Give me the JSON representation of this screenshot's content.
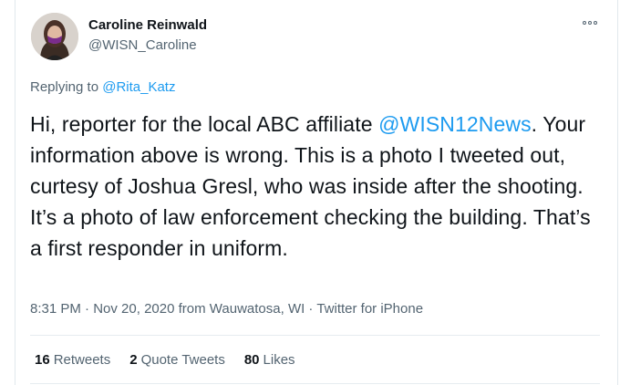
{
  "author": {
    "name": "Caroline Reinwald",
    "handle": "@WISN_Caroline"
  },
  "reply": {
    "prefix": "Replying to ",
    "to": "@Rita_Katz"
  },
  "tweet": {
    "text_before": "Hi, reporter for the local ABC affiliate ",
    "mention": "@WISN12News",
    "text_after": ". Your information above is wrong. This is a photo I tweeted out, curtesy of Joshua Gresl, who was inside after the shooting. It’s a photo of law enforcement checking the building. That’s a first responder in uniform."
  },
  "meta": {
    "time": "8:31 PM",
    "date": "Nov 20, 2020",
    "location": "from Wauwatosa, WI",
    "source": "Twitter for iPhone"
  },
  "stats": {
    "retweets_count": "16",
    "retweets_label": "Retweets",
    "quotes_count": "2",
    "quotes_label": "Quote Tweets",
    "likes_count": "80",
    "likes_label": "Likes"
  },
  "colors": {
    "link": "#1d9bf0",
    "text": "#0f1419",
    "secondary": "#536471"
  },
  "icons": {
    "more": "more-options-icon"
  }
}
